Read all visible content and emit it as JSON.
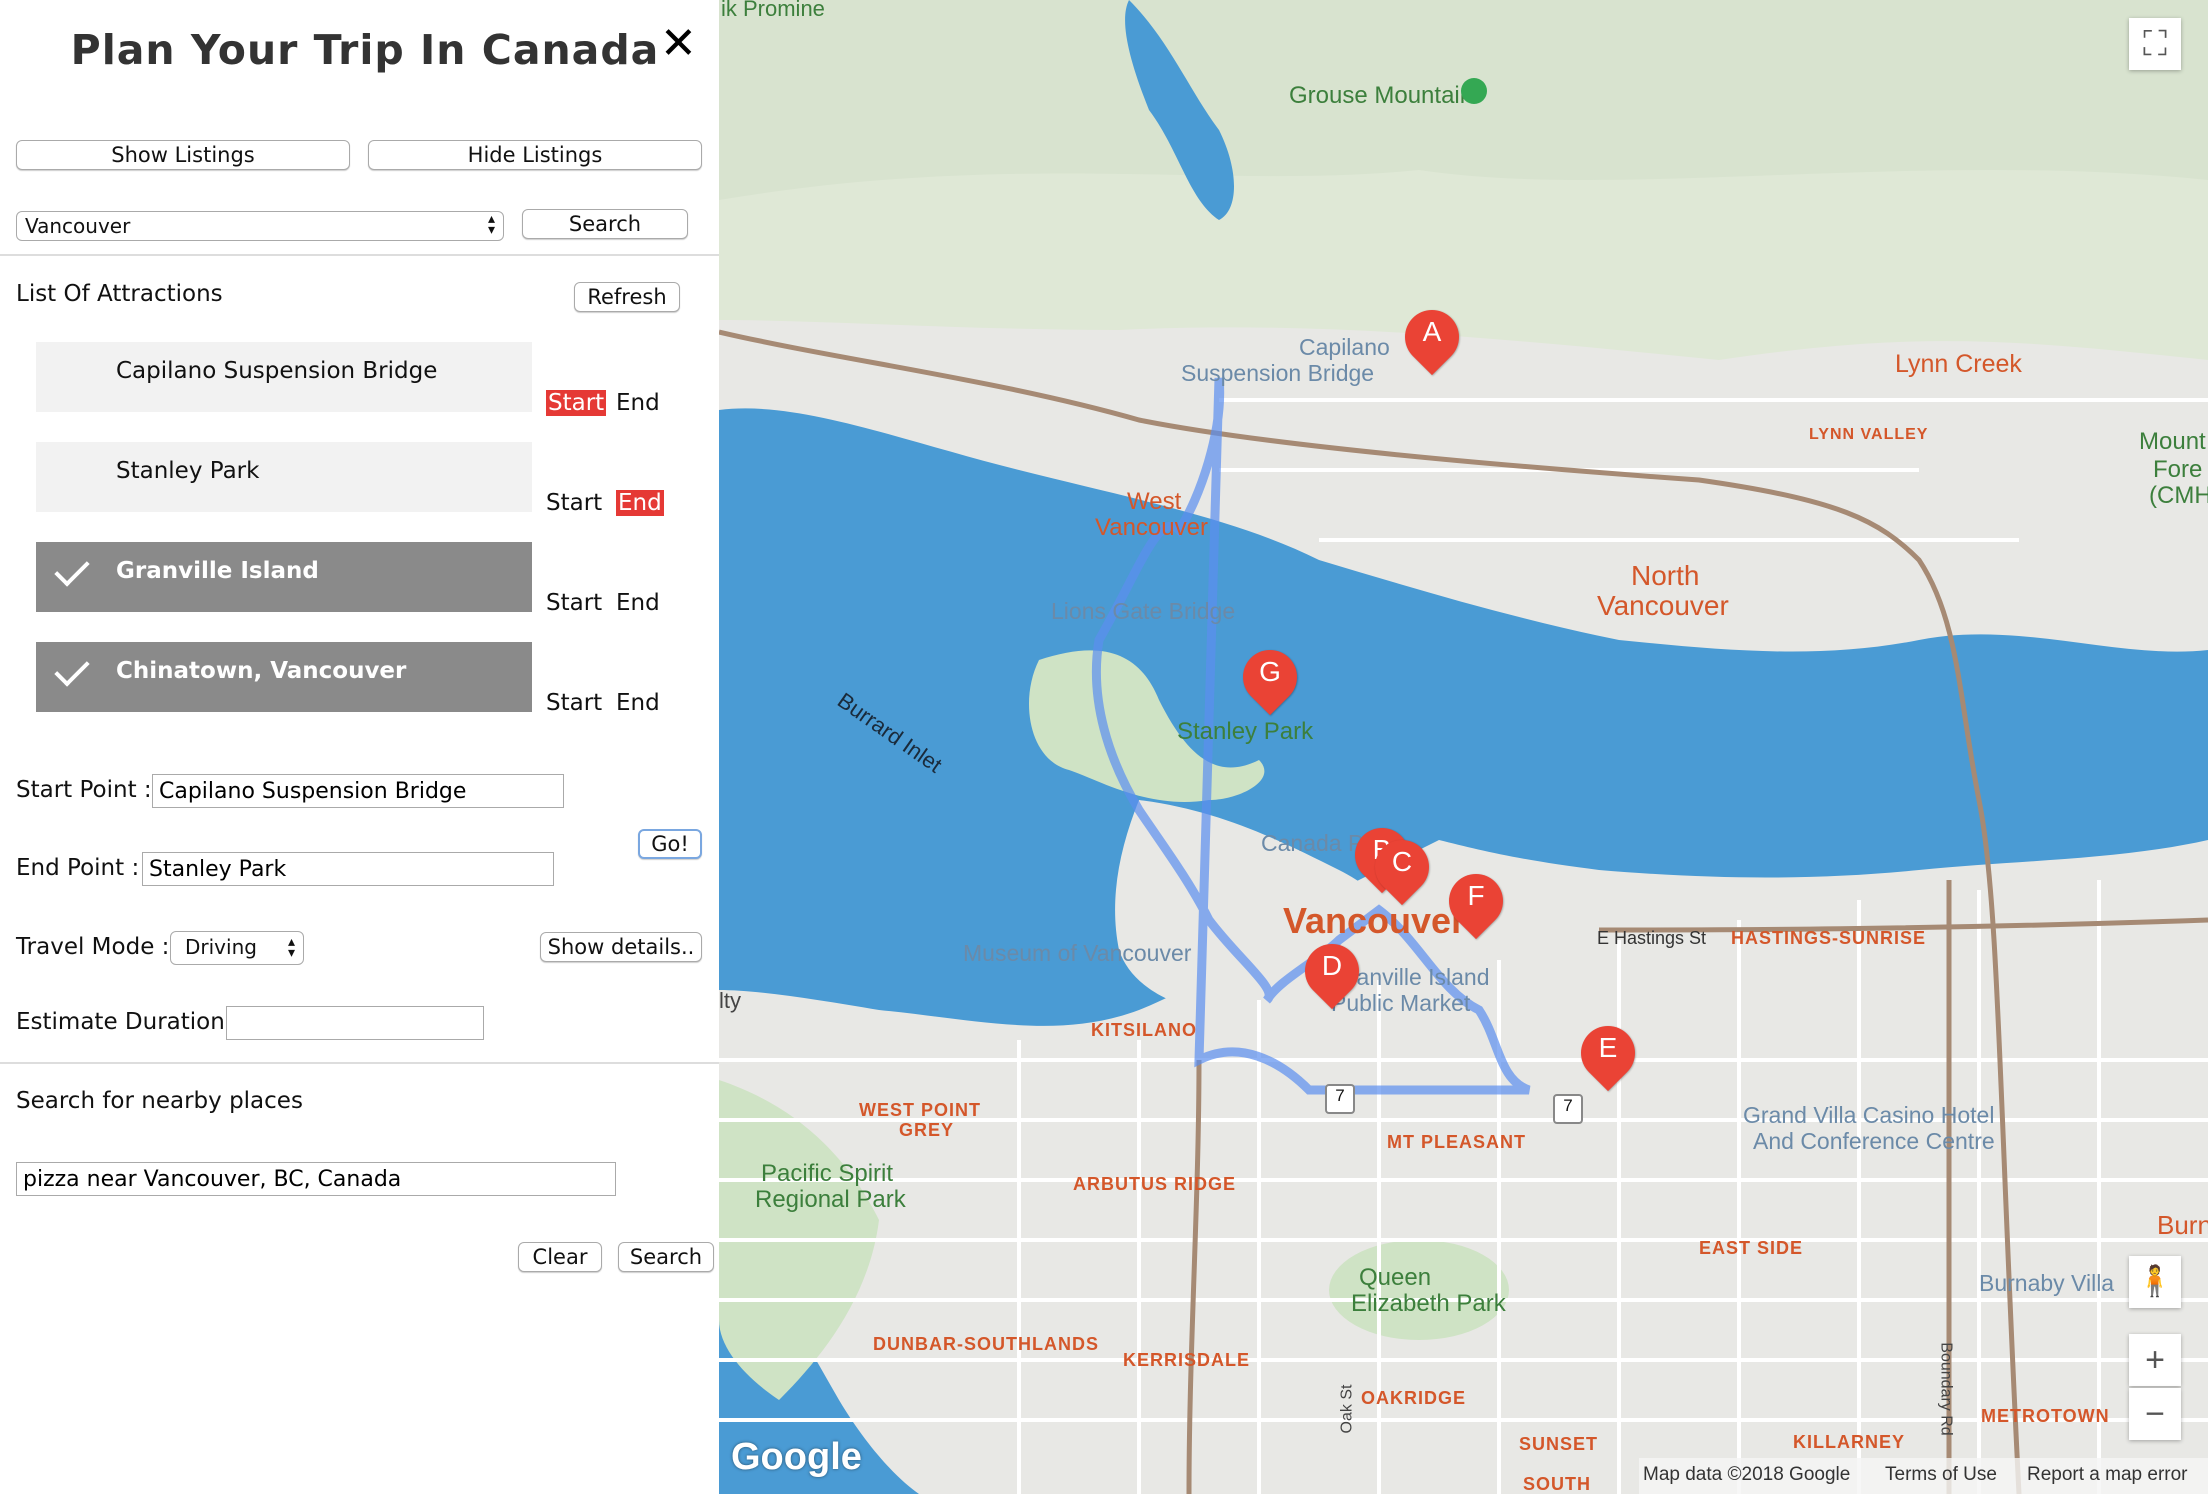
{
  "sidebar": {
    "title": "Plan Your Trip In Canada",
    "close_glyph": "✕",
    "show_listings": "Show Listings",
    "hide_listings": "Hide Listings",
    "city_select": "Vancouver",
    "search_btn": "Search",
    "list_heading": "List Of Attractions",
    "refresh_btn": "Refresh",
    "attractions": [
      {
        "name": "Capilano Suspension Bridge",
        "selected": false,
        "start_label": "Start",
        "end_label": "End",
        "start_active": true,
        "end_active": false
      },
      {
        "name": "Stanley Park",
        "selected": false,
        "start_label": "Start",
        "end_label": "End",
        "start_active": false,
        "end_active": true
      },
      {
        "name": "Granville Island",
        "selected": true,
        "start_label": "Start",
        "end_label": "End",
        "start_active": false,
        "end_active": false
      },
      {
        "name": "Chinatown, Vancouver",
        "selected": true,
        "start_label": "Start",
        "end_label": "End",
        "start_active": false,
        "end_active": false
      }
    ],
    "start_point_label": "Start Point :",
    "start_point_value": "Capilano Suspension Bridge",
    "end_point_label": "End Point :",
    "end_point_value": "Stanley Park",
    "go_btn": "Go!",
    "travel_mode_label": "Travel Mode :",
    "travel_mode_value": "Driving",
    "show_details_btn": "Show details..",
    "estimate_label": "Estimate Duration:",
    "estimate_value": "",
    "nearby_heading": "Search for nearby places",
    "nearby_value": "pizza near Vancouver, BC, Canada",
    "clear_btn": "Clear",
    "nearby_search_btn": "Search"
  },
  "map": {
    "markers": [
      "A",
      "B",
      "C",
      "D",
      "E",
      "F",
      "G"
    ],
    "labels": {
      "grouse": "Grouse Mountain",
      "capilano": "Capilano",
      "capilano2": "Suspension Bridge",
      "lynn_creek": "Lynn Creek",
      "lynn_valley": "LYNN VALLEY",
      "mount1": "Mount",
      "mount2": "Fore",
      "mount3": "(CMH",
      "west_vancouver1": "West",
      "west_vancouver2": "Vancouver",
      "north_vancouver1": "North",
      "north_vancouver2": "Vancouver",
      "lions_gate": "Lions Gate Bridge",
      "burrard_inlet": "Burrard Inlet",
      "stanley_park": "Stanley Park",
      "canada_place": "Canada Place",
      "vancouver": "Vancouver",
      "hastings_st": "E Hastings St",
      "hastings_sunrise": "HASTINGS-SUNRISE",
      "museum": "Museum of Vancouver",
      "granville1": "Granville Island",
      "granville2": "Public Market",
      "kitsilano": "KITSILANO",
      "west_point_grey1": "WEST POINT",
      "west_point_grey2": "GREY",
      "mt_pleasant": "MT PLEASANT",
      "arbutus": "ARBUTUS RIDGE",
      "pacific_spirit1": "Pacific Spirit",
      "pacific_spirit2": "Regional Park",
      "grand_villa1": "Grand Villa Casino Hotel",
      "grand_villa2": "And Conference Centre",
      "east_side": "EAST SIDE",
      "burnaby_villa": "Burnaby Villa",
      "burn": "Burn",
      "queen_elizabeth1": "Queen",
      "queen_elizabeth2": "Elizabeth Park",
      "dunbar": "DUNBAR-SOUTHLANDS",
      "kerrisdale": "KERRISDALE",
      "oakridge": "OAKRIDGE",
      "oak_st": "Oak St",
      "sunset": "SUNSET",
      "south": "SOUTH",
      "killarney": "KILLARNEY",
      "metrotown": "METROTOWN",
      "boundary": "Boundary Rd",
      "route7a": "7",
      "route7b": "7",
      "lty": "lty",
      "top_partial": "ik Promine"
    },
    "footer": {
      "google": "Google",
      "map_data": "Map data ©2018 Google",
      "terms": "Terms of Use",
      "report": "Report a map error"
    },
    "zoom_in": "+",
    "zoom_out": "−",
    "colors": {
      "water": "#4a9bd4",
      "route": "#5b8ef0",
      "marker": "#ea4335",
      "land": "#e8e8e5",
      "park": "#cfe3c5"
    }
  }
}
